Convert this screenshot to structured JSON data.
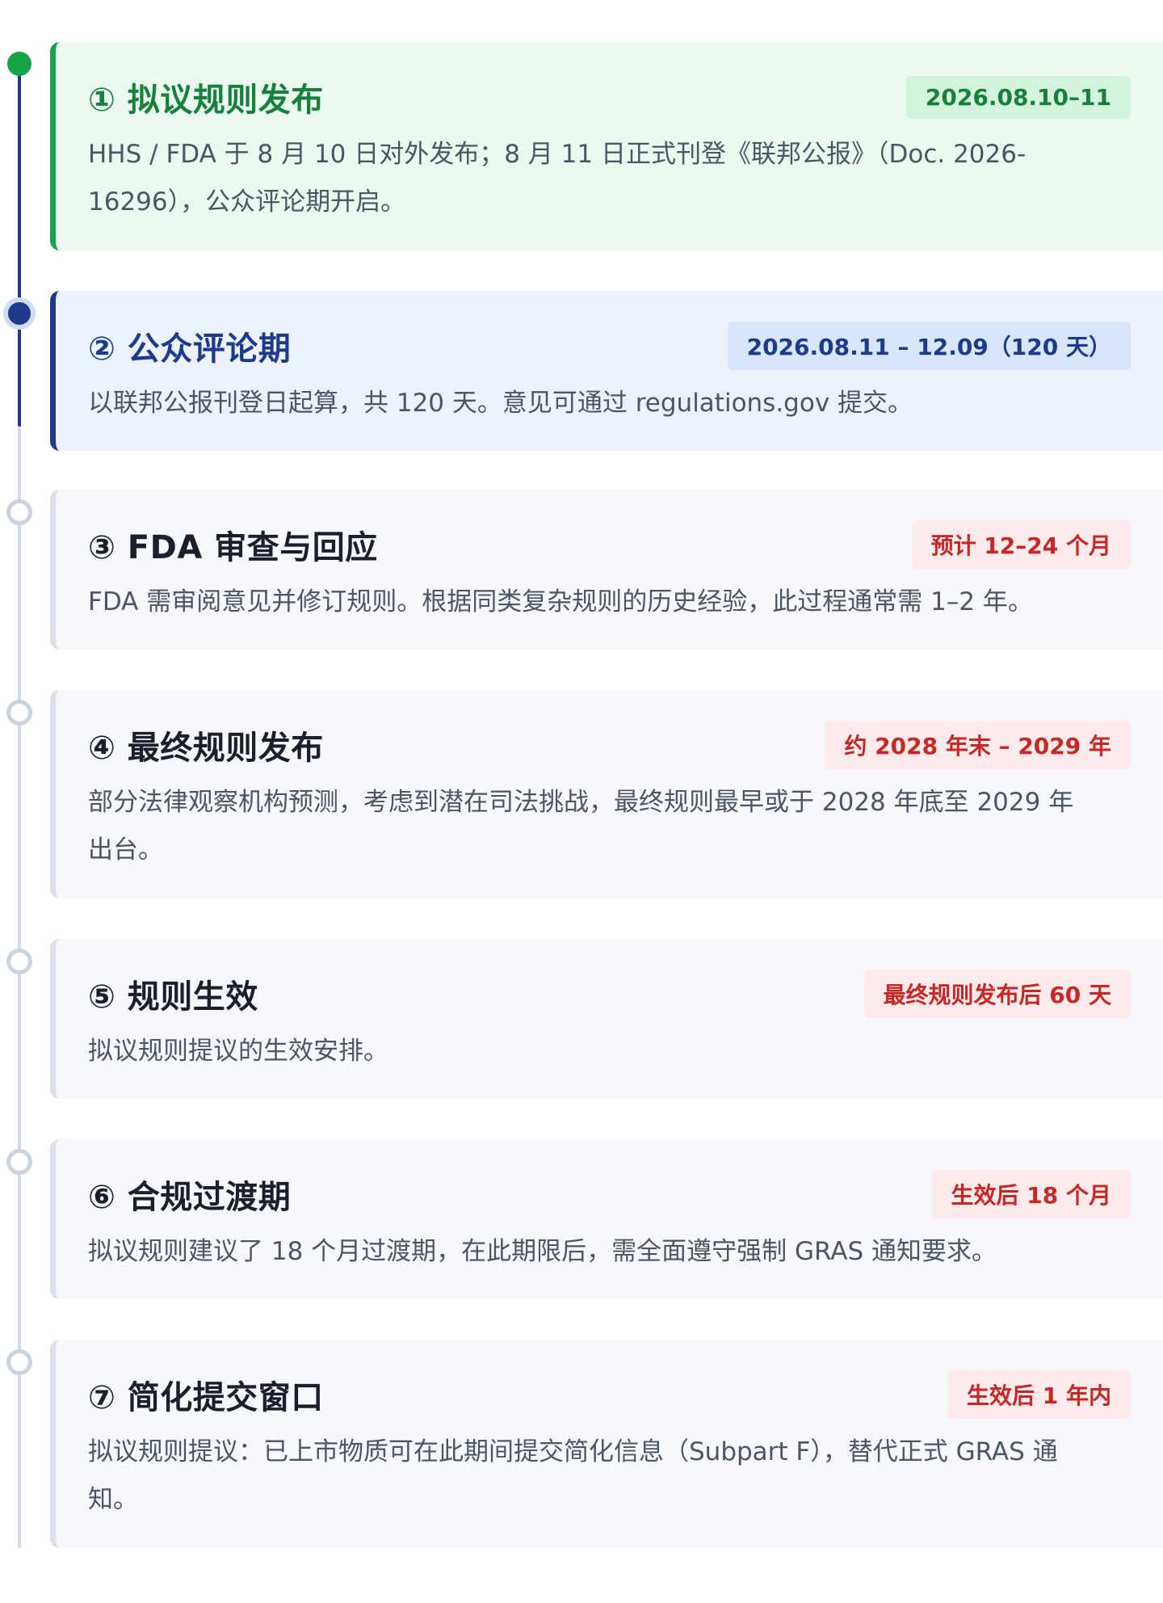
{
  "steps": [
    {
      "title": "① 拟议规则发布",
      "badge": "2026.08.10–11",
      "desc": "HHS / FDA 于 8 月 10 日对外发布；8 月 11 日正式刊登《联邦公报》（Doc. 2026-16296），公众评论期开启。",
      "status": "done"
    },
    {
      "title": "② 公众评论期",
      "badge": "2026.08.11 – 12.09（120 天）",
      "desc": "以联邦公报刊登日起算，共 120 天。意见可通过 regulations.gov 提交。",
      "status": "current"
    },
    {
      "title": "③ FDA 审查与回应",
      "badge": "预计 12–24 个月",
      "desc": "FDA 需审阅意见并修订规则。根据同类复杂规则的历史经验，此过程通常需 1–2 年。",
      "status": "future"
    },
    {
      "title": "④ 最终规则发布",
      "badge": "约 2028 年末 – 2029 年",
      "desc": "部分法律观察机构预测，考虑到潜在司法挑战，最终规则最早或于 2028 年底至 2029 年出台。",
      "status": "future"
    },
    {
      "title": "⑤ 规则生效",
      "badge": "最终规则发布后 60 天",
      "desc": "拟议规则提议的生效安排。",
      "status": "future"
    },
    {
      "title": "⑥ 合规过渡期",
      "badge": "生效后 18 个月",
      "desc": "拟议规则建议了 18 个月过渡期，在此期限后，需全面遵守强制 GRAS 通知要求。",
      "status": "future"
    },
    {
      "title": "⑦ 简化提交窗口",
      "badge": "生效后 1 年内",
      "desc": "拟议规则提议：已上市物质可在此期间提交简化信息（Subpart F），替代正式 GRAS 通知。",
      "status": "future"
    }
  ],
  "colors": {
    "done": "#16a34a",
    "current": "#1e3a8a",
    "future": "#c62828"
  }
}
